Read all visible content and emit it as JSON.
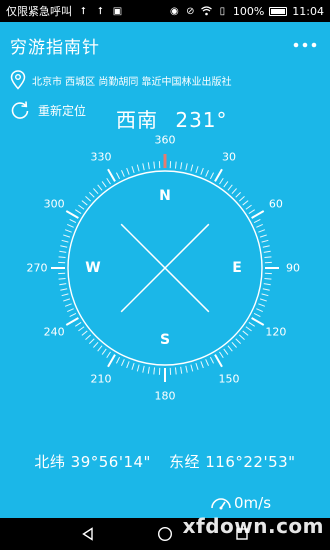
{
  "status_bar": {
    "carrier": "仅限紧急呼叫",
    "battery": "100%",
    "time": "11:04"
  },
  "app_bar": {
    "title": "穷游指南针",
    "more_icon": "more-vertical-dots-icon"
  },
  "location": {
    "address": "北京市 西城区 尚勤胡同 靠近中国林业出版社",
    "icon": "location-pin-icon"
  },
  "relocate": {
    "label": "重新定位",
    "icon": "refresh-icon"
  },
  "heading": {
    "direction": "西南",
    "degrees": "231°"
  },
  "compass": {
    "degree_labels": [
      "360",
      "30",
      "60",
      "90",
      "120",
      "150",
      "180",
      "210",
      "240",
      "270",
      "300",
      "330"
    ],
    "cardinal_labels": {
      "n": "N",
      "e": "E",
      "s": "S",
      "w": "W"
    },
    "heading_value": 231
  },
  "coordinates": {
    "latitude": "北纬 39°56'14\"",
    "longitude": "东经 116°22'53\""
  },
  "speed": {
    "value": "0m/s",
    "icon": "speedometer-icon"
  },
  "watermark": "xfdown.com",
  "colors": {
    "background": "#1bb7e8",
    "accent_tick": "#e57b6f"
  }
}
